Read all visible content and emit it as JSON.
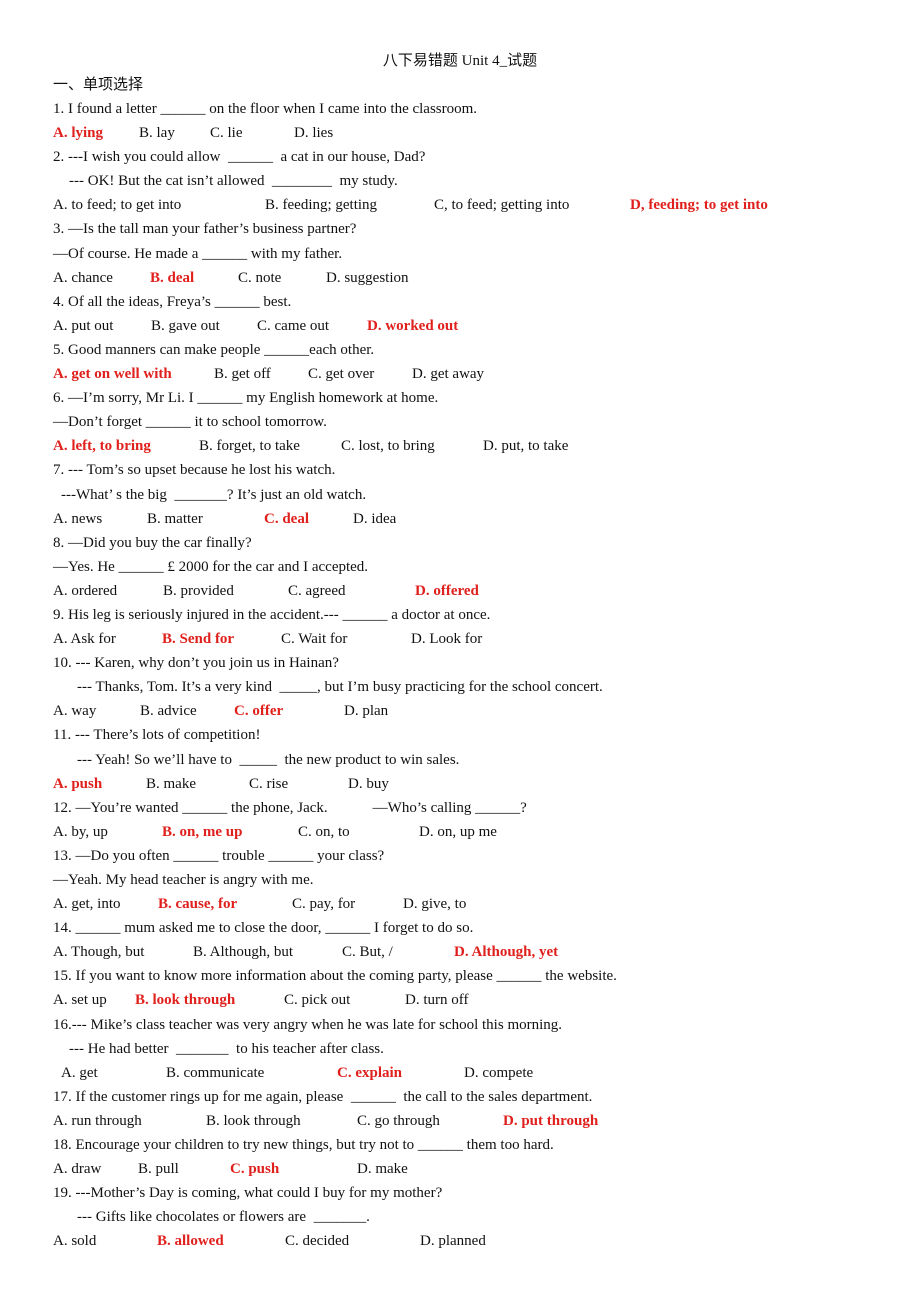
{
  "title": "八下易错题  Unit 4_试题",
  "section": "一、单项选择",
  "accent_color": "#e0201c",
  "questions": [
    {
      "lines": [
        "1. I found a letter ______ on the floor when I came into the classroom."
      ],
      "options": [
        "A. lying",
        "B. lay",
        "C. lie",
        "D. lies"
      ],
      "answer": 0
    },
    {
      "lines": [
        "2. ---I wish you could allow  ______  a cat in our house, Dad?",
        "--- OK! But the cat isn’t allowed  ________  my study."
      ],
      "options": [
        "A. to feed; to get into",
        "B. feeding; getting",
        "C, to feed; getting into",
        "D, feeding; to get into"
      ],
      "answer": 3
    },
    {
      "lines": [
        "3. —Is the tall man your father’s business partner?",
        "—Of course. He made a ______ with my father."
      ],
      "options": [
        "A. chance",
        "B. deal",
        "C. note",
        "D. suggestion"
      ],
      "answer": 1
    },
    {
      "lines": [
        "4. Of all the ideas, Freya’s ______ best."
      ],
      "options": [
        "A. put out",
        "B. gave out",
        "C. came out",
        "D. worked out"
      ],
      "answer": 3
    },
    {
      "lines": [
        "5. Good manners can make people ______each other."
      ],
      "options": [
        "A. get on well with",
        "B. get off",
        "C. get over",
        "D. get away"
      ],
      "answer": 0
    },
    {
      "lines": [
        "6. —I’m sorry, Mr Li. I ______ my English homework at home.",
        "—Don’t forget ______ it to school tomorrow."
      ],
      "options": [
        "A. left, to bring",
        "B. forget, to take",
        "C. lost, to bring",
        "D. put, to take"
      ],
      "answer": 0
    },
    {
      "lines": [
        "7. --- Tom’s so upset because he lost his watch.",
        "---What’ s the big  _______? It’s just an old watch."
      ],
      "options": [
        "A. news",
        "B. matter",
        "C. deal",
        "D. idea"
      ],
      "answer": 2
    },
    {
      "lines": [
        "8. —Did you buy the car finally?",
        "—Yes. He ______ £ 2000 for the car and I accepted."
      ],
      "options": [
        "A. ordered",
        "B. provided",
        "C. agreed",
        "D. offered"
      ],
      "answer": 3
    },
    {
      "lines": [
        "9. His leg is seriously injured in the accident.--- ______ a doctor at once."
      ],
      "options": [
        "A. Ask for",
        "B. Send for",
        "C. Wait for",
        "D. Look for"
      ],
      "answer": 1
    },
    {
      "lines": [
        "10. --- Karen, why don’t you join us in Hainan?",
        "--- Thanks, Tom. It’s a very kind  _____, but I’m busy practicing for the school concert."
      ],
      "options": [
        "A. way",
        "B. advice",
        "C. offer",
        "D. plan"
      ],
      "answer": 2
    },
    {
      "lines": [
        "11. --- There’s lots of competition!",
        "--- Yeah! So we’ll have to  _____  the new product to win sales."
      ],
      "options": [
        "A. push",
        "B. make",
        "C. rise",
        "D. buy"
      ],
      "answer": 0
    },
    {
      "lines": [
        "12. —You’re wanted ______ the phone, Jack.            —Who’s calling ______?"
      ],
      "options": [
        "A. by, up",
        "B. on, me up",
        "C. on, to",
        "D. on, up me"
      ],
      "answer": 1
    },
    {
      "lines": [
        "13. —Do you often ______ trouble ______ your class?",
        "—Yeah. My head teacher is angry with me."
      ],
      "options": [
        "A. get, into",
        "B. cause, for",
        "C. pay, for",
        "D. give, to"
      ],
      "answer": 1
    },
    {
      "lines": [
        "14. ______ mum asked me to close the door, ______ I forget to do so."
      ],
      "options": [
        "A. Though, but",
        "B. Although, but",
        "C. But, /",
        "D. Although, yet"
      ],
      "answer": 3
    },
    {
      "lines": [
        "15. If you want to know more information about the coming party, please ______ the website."
      ],
      "options": [
        "A. set up",
        "B. look through",
        "C. pick out",
        "D. turn off"
      ],
      "answer": 1
    },
    {
      "lines": [
        "16.--- Mike’s class teacher was very angry when he was late for school this morning.",
        "--- He had better  _______  to his teacher after class."
      ],
      "options": [
        "A. get",
        "B. communicate",
        "C. explain",
        "D. compete"
      ],
      "answer": 2
    },
    {
      "lines": [
        "17. If the customer rings up for me again, please  ______  the call to the sales department."
      ],
      "options": [
        "A. run through",
        "B. look through",
        "C. go through",
        "D. put through"
      ],
      "answer": 3
    },
    {
      "lines": [
        "18. Encourage your children to try new things, but try not to ______ them too hard."
      ],
      "options": [
        "A. draw",
        "B. pull",
        "C. push",
        "D. make"
      ],
      "answer": 2
    },
    {
      "lines": [
        "19. ---Mother’s Day is coming, what could I buy for my mother?",
        "--- Gifts like chocolates or flowers are  _______."
      ],
      "options": [
        "A. sold",
        "B. allowed",
        "C. decided",
        "D. planned"
      ],
      "answer": 1
    }
  ]
}
